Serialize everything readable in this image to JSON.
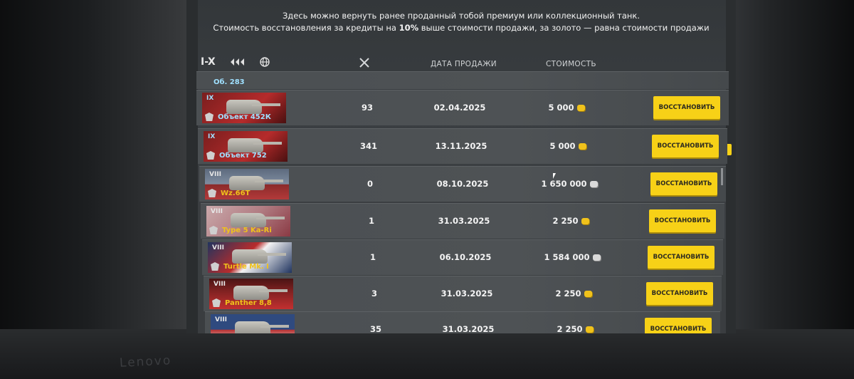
{
  "info": {
    "line1": "Здесь можно вернуть ранее проданный тобой премиум или коллекционный танк.",
    "line2_a": "Стоимость восстановления за кредиты на ",
    "line2_b": "10%",
    "line2_c": " выше стоимости продажи, за золото — равна стоимости продажи"
  },
  "filters": {
    "tier_label": "I-X"
  },
  "columns": {
    "date": "ДАТА ПРОДАЖИ",
    "cost": "СТОИМОСТЬ"
  },
  "partial_row": {
    "name": "Об. 283"
  },
  "rows": [
    {
      "tier": "IX",
      "name": "Объект 452К",
      "battles": "93",
      "date": "02.04.2025",
      "cost": "5 000",
      "currency": "gold",
      "button": "ВОССТАНОВИТЬ"
    },
    {
      "tier": "IX",
      "name": "Объект 752",
      "battles": "341",
      "date": "13.11.2025",
      "cost": "5 000",
      "currency": "gold",
      "button": "ВОССТАНОВИТЬ"
    },
    {
      "tier": "VIII",
      "name": "Wz.66T",
      "battles": "0",
      "date": "08.10.2025",
      "cost": "1 650 000",
      "currency": "credits",
      "button": "ВОССТАНОВИТЬ"
    },
    {
      "tier": "VIII",
      "name": "Type 5 Ka-Ri",
      "battles": "1",
      "date": "31.03.2025",
      "cost": "2 250",
      "currency": "gold",
      "button": "ВОССТАНОВИТЬ"
    },
    {
      "tier": "VIII",
      "name": "Turtle Mk. I",
      "battles": "1",
      "date": "06.10.2025",
      "cost": "1 584 000",
      "currency": "credits",
      "button": "ВОССТАНОВИТЬ"
    },
    {
      "tier": "VIII",
      "name": "Panther 8,8",
      "battles": "3",
      "date": "31.03.2025",
      "cost": "2 250",
      "currency": "gold",
      "button": "ВОССТАНОВИТЬ"
    },
    {
      "tier": "VIII",
      "name": "",
      "battles": "35",
      "date": "31.03.2025",
      "cost": "2 250",
      "currency": "gold",
      "button": "ВОССТАНОВИТЬ"
    }
  ],
  "bezel": {
    "brand": "Lenovo"
  },
  "colors": {
    "button": "#f7d117",
    "name_premium": "#f0c21b",
    "name_collector": "#9fe0ff",
    "gold": "#f0c21b"
  }
}
